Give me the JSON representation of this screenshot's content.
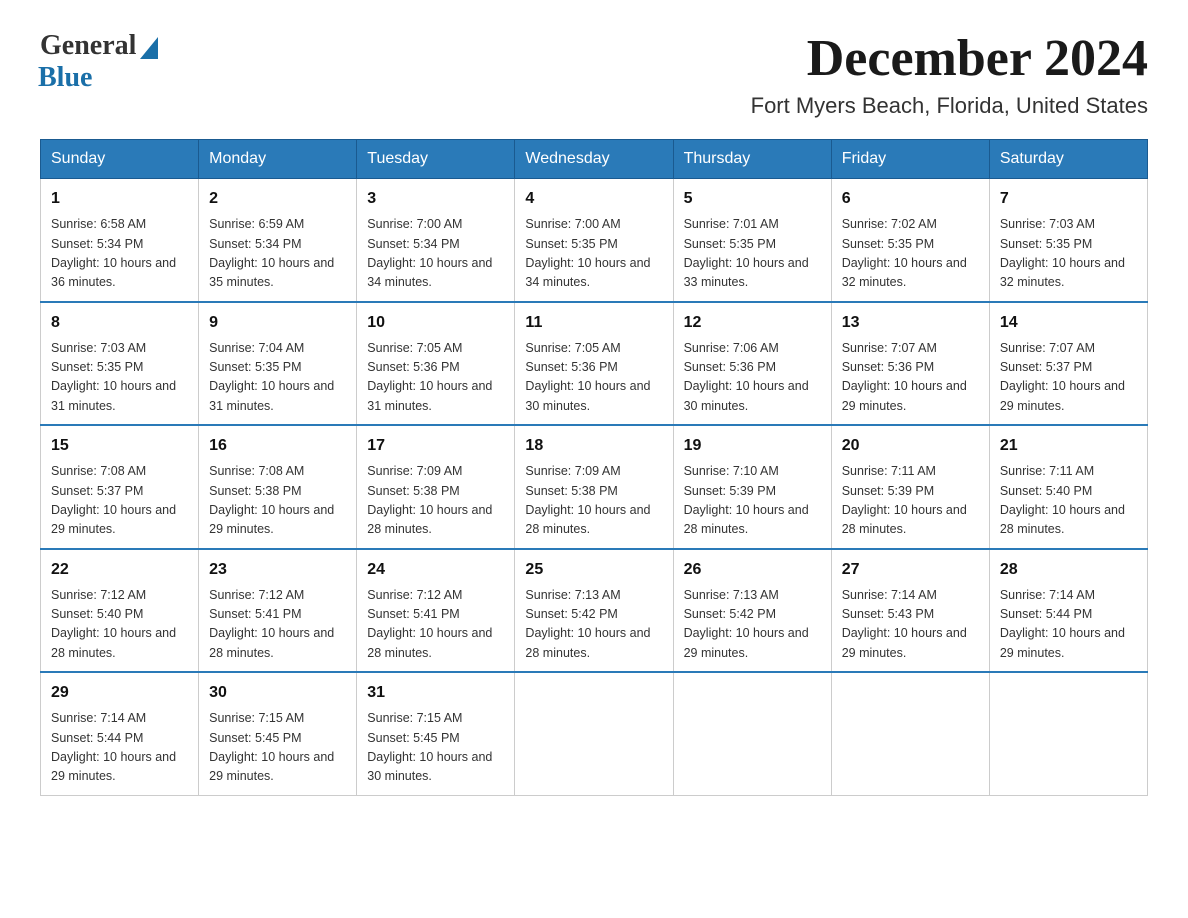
{
  "logo": {
    "general": "General",
    "blue": "Blue"
  },
  "title": {
    "month": "December 2024",
    "location": "Fort Myers Beach, Florida, United States"
  },
  "headers": [
    "Sunday",
    "Monday",
    "Tuesday",
    "Wednesday",
    "Thursday",
    "Friday",
    "Saturday"
  ],
  "weeks": [
    [
      {
        "day": "1",
        "sunrise": "6:58 AM",
        "sunset": "5:34 PM",
        "daylight": "10 hours and 36 minutes."
      },
      {
        "day": "2",
        "sunrise": "6:59 AM",
        "sunset": "5:34 PM",
        "daylight": "10 hours and 35 minutes."
      },
      {
        "day": "3",
        "sunrise": "7:00 AM",
        "sunset": "5:34 PM",
        "daylight": "10 hours and 34 minutes."
      },
      {
        "day": "4",
        "sunrise": "7:00 AM",
        "sunset": "5:35 PM",
        "daylight": "10 hours and 34 minutes."
      },
      {
        "day": "5",
        "sunrise": "7:01 AM",
        "sunset": "5:35 PM",
        "daylight": "10 hours and 33 minutes."
      },
      {
        "day": "6",
        "sunrise": "7:02 AM",
        "sunset": "5:35 PM",
        "daylight": "10 hours and 32 minutes."
      },
      {
        "day": "7",
        "sunrise": "7:03 AM",
        "sunset": "5:35 PM",
        "daylight": "10 hours and 32 minutes."
      }
    ],
    [
      {
        "day": "8",
        "sunrise": "7:03 AM",
        "sunset": "5:35 PM",
        "daylight": "10 hours and 31 minutes."
      },
      {
        "day": "9",
        "sunrise": "7:04 AM",
        "sunset": "5:35 PM",
        "daylight": "10 hours and 31 minutes."
      },
      {
        "day": "10",
        "sunrise": "7:05 AM",
        "sunset": "5:36 PM",
        "daylight": "10 hours and 31 minutes."
      },
      {
        "day": "11",
        "sunrise": "7:05 AM",
        "sunset": "5:36 PM",
        "daylight": "10 hours and 30 minutes."
      },
      {
        "day": "12",
        "sunrise": "7:06 AM",
        "sunset": "5:36 PM",
        "daylight": "10 hours and 30 minutes."
      },
      {
        "day": "13",
        "sunrise": "7:07 AM",
        "sunset": "5:36 PM",
        "daylight": "10 hours and 29 minutes."
      },
      {
        "day": "14",
        "sunrise": "7:07 AM",
        "sunset": "5:37 PM",
        "daylight": "10 hours and 29 minutes."
      }
    ],
    [
      {
        "day": "15",
        "sunrise": "7:08 AM",
        "sunset": "5:37 PM",
        "daylight": "10 hours and 29 minutes."
      },
      {
        "day": "16",
        "sunrise": "7:08 AM",
        "sunset": "5:38 PM",
        "daylight": "10 hours and 29 minutes."
      },
      {
        "day": "17",
        "sunrise": "7:09 AM",
        "sunset": "5:38 PM",
        "daylight": "10 hours and 28 minutes."
      },
      {
        "day": "18",
        "sunrise": "7:09 AM",
        "sunset": "5:38 PM",
        "daylight": "10 hours and 28 minutes."
      },
      {
        "day": "19",
        "sunrise": "7:10 AM",
        "sunset": "5:39 PM",
        "daylight": "10 hours and 28 minutes."
      },
      {
        "day": "20",
        "sunrise": "7:11 AM",
        "sunset": "5:39 PM",
        "daylight": "10 hours and 28 minutes."
      },
      {
        "day": "21",
        "sunrise": "7:11 AM",
        "sunset": "5:40 PM",
        "daylight": "10 hours and 28 minutes."
      }
    ],
    [
      {
        "day": "22",
        "sunrise": "7:12 AM",
        "sunset": "5:40 PM",
        "daylight": "10 hours and 28 minutes."
      },
      {
        "day": "23",
        "sunrise": "7:12 AM",
        "sunset": "5:41 PM",
        "daylight": "10 hours and 28 minutes."
      },
      {
        "day": "24",
        "sunrise": "7:12 AM",
        "sunset": "5:41 PM",
        "daylight": "10 hours and 28 minutes."
      },
      {
        "day": "25",
        "sunrise": "7:13 AM",
        "sunset": "5:42 PM",
        "daylight": "10 hours and 28 minutes."
      },
      {
        "day": "26",
        "sunrise": "7:13 AM",
        "sunset": "5:42 PM",
        "daylight": "10 hours and 29 minutes."
      },
      {
        "day": "27",
        "sunrise": "7:14 AM",
        "sunset": "5:43 PM",
        "daylight": "10 hours and 29 minutes."
      },
      {
        "day": "28",
        "sunrise": "7:14 AM",
        "sunset": "5:44 PM",
        "daylight": "10 hours and 29 minutes."
      }
    ],
    [
      {
        "day": "29",
        "sunrise": "7:14 AM",
        "sunset": "5:44 PM",
        "daylight": "10 hours and 29 minutes."
      },
      {
        "day": "30",
        "sunrise": "7:15 AM",
        "sunset": "5:45 PM",
        "daylight": "10 hours and 29 minutes."
      },
      {
        "day": "31",
        "sunrise": "7:15 AM",
        "sunset": "5:45 PM",
        "daylight": "10 hours and 30 minutes."
      },
      null,
      null,
      null,
      null
    ]
  ]
}
